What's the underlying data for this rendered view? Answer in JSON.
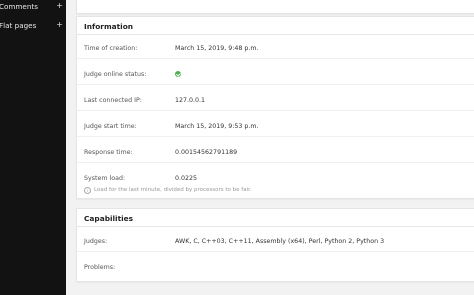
{
  "sidebar": {
    "items": [
      {
        "label": "Comments",
        "expand": "+"
      },
      {
        "label": "Flat pages",
        "expand": "+"
      }
    ]
  },
  "information": {
    "title": "Information",
    "rows": [
      {
        "key": "Time of creation:",
        "value": "March 15, 2019, 9:48 p.m."
      },
      {
        "key": "Judge online status:",
        "value": ""
      },
      {
        "key": "Last connected IP:",
        "value": "127.0.0.1"
      },
      {
        "key": "Judge start time:",
        "value": "March 15, 2019, 9:53 p.m."
      },
      {
        "key": "Response time:",
        "value": "0.00154562791189"
      },
      {
        "key": "System load:",
        "value": "0.0225"
      }
    ],
    "system_load_help": "Load for the last minute, divided by processors to be fair.",
    "online_status_icon": "check-circle-icon"
  },
  "capabilities": {
    "title": "Capabilities",
    "rows": [
      {
        "key": "Judges:",
        "value": "AWK, C, C++03, C++11, Assembly (x64), Perl, Python 2, Python 3"
      },
      {
        "key": "Problems:",
        "value": ""
      }
    ]
  },
  "colors": {
    "sidebar_bg": "#121212",
    "status_ok": "#4caf50"
  }
}
